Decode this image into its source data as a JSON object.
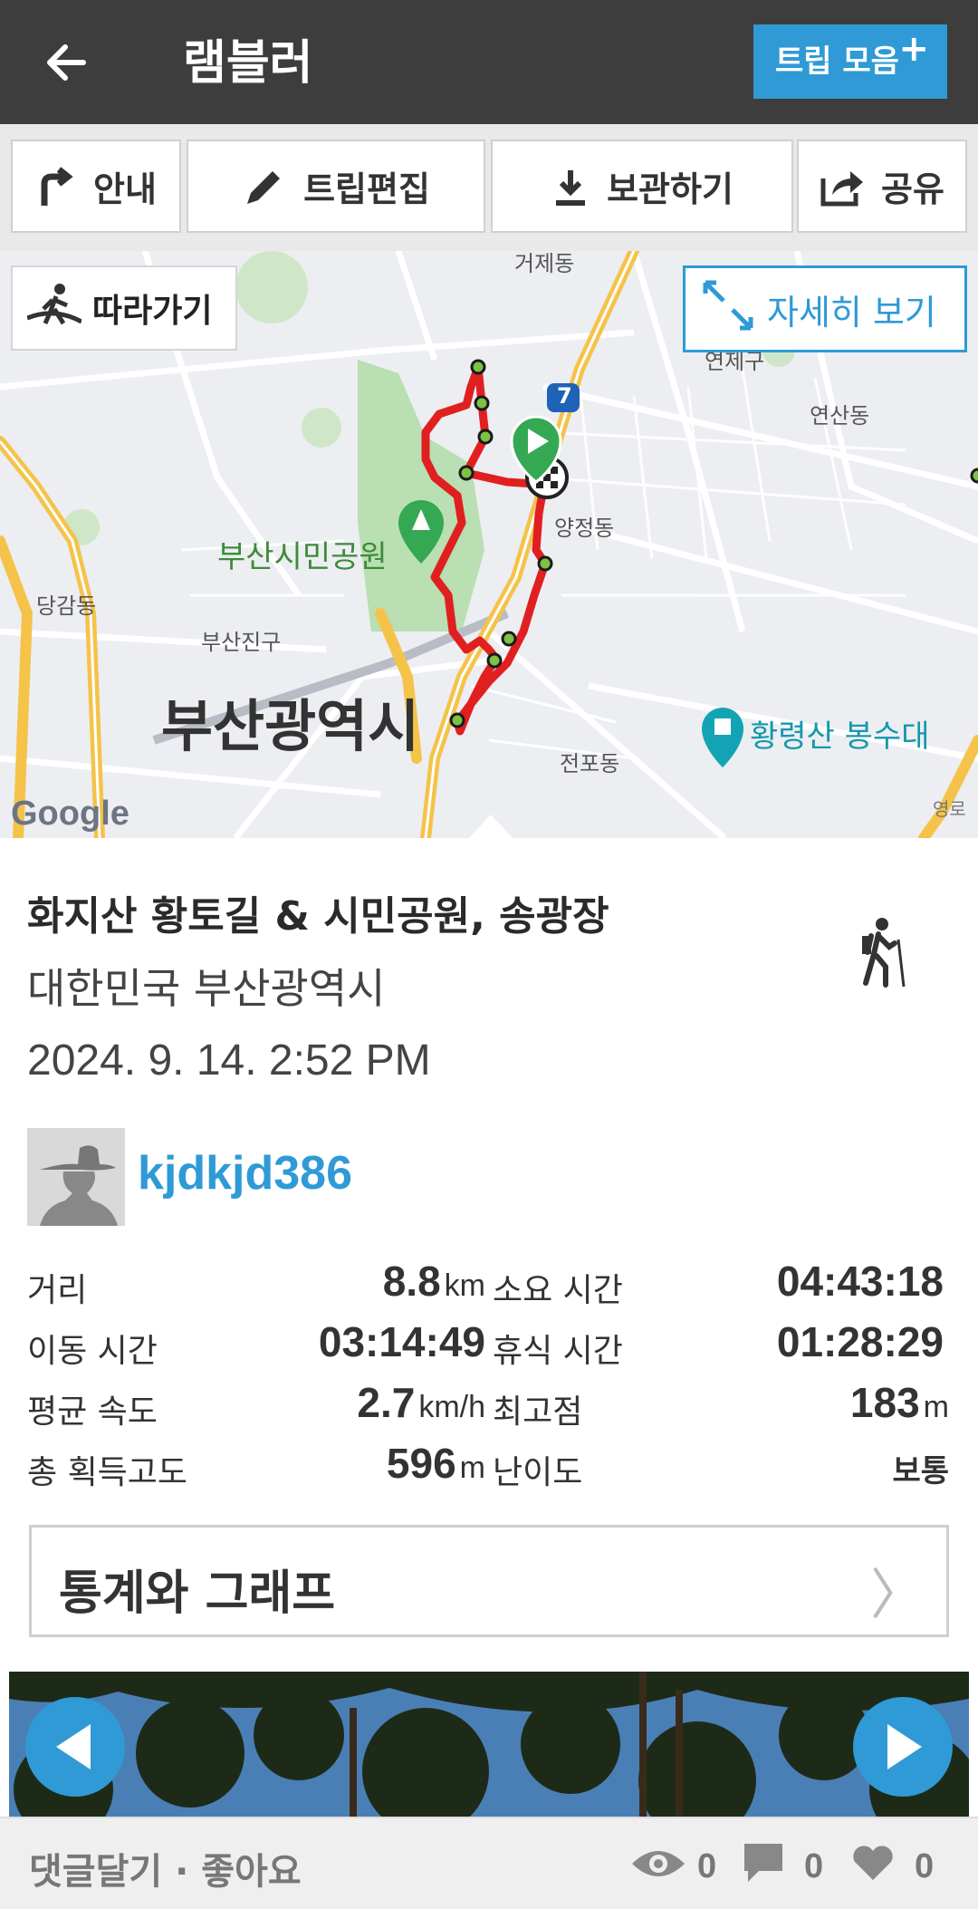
{
  "header": {
    "title": "램블러",
    "trip_collection_label": "트립 모음",
    "trip_collection_plus": "+"
  },
  "toolbar": {
    "guide_label": "안내",
    "edit_label": "트립편집",
    "save_label": "보관하기",
    "share_label": "공유"
  },
  "map": {
    "follow_label": "따라가기",
    "detail_label": "자세히 보기",
    "labels": {
      "geoje": "거제동",
      "yeonje": "연제구",
      "yeonsan": "연산동",
      "yangjeong": "양정동",
      "park": "부산시민공원",
      "danggam": "당감동",
      "busanjin": "부산진구",
      "busan": "부산광역시",
      "hwangnyeong": "황령산 봉수대",
      "jeonpo": "전포동",
      "road": "7",
      "google": "Google",
      "edge": "영로"
    },
    "colors": {
      "route": "#e02020",
      "road": "#f5c34a",
      "park": "#b9dfb2",
      "marker": "#34a853"
    }
  },
  "trip": {
    "title": "화지산 황토길 & 시민공원, 송광장",
    "location": "대한민국 부산광역시",
    "datetime": "2024. 9. 14. 2:52 PM",
    "activity_icon": "hiking-icon",
    "username": "kjdkjd386"
  },
  "stats": {
    "distance_label": "거리",
    "distance_value": "8.8",
    "distance_unit": "km",
    "duration_label": "소요 시간",
    "duration_value": "04:43:18",
    "moving_label": "이동 시간",
    "moving_value": "03:14:49",
    "rest_label": "휴식 시간",
    "rest_value": "01:28:29",
    "speed_label": "평균 속도",
    "speed_value": "2.7",
    "speed_unit": "km/h",
    "max_alt_label": "최고점",
    "max_alt_value": "183",
    "max_alt_unit": "m",
    "gain_label": "총 획득고도",
    "gain_value": "596",
    "gain_unit": "m",
    "difficulty_label": "난이도",
    "difficulty_value": "보통"
  },
  "stats_button_label": "통계와 그래프",
  "stats_button_chevron": "〉",
  "footer": {
    "comment_like_label": "댓글달기 · 좋아요",
    "views": "0",
    "comments": "0",
    "likes": "0"
  },
  "colors": {
    "accent": "#2f9ad6",
    "header_bg": "#3d3d3d"
  }
}
